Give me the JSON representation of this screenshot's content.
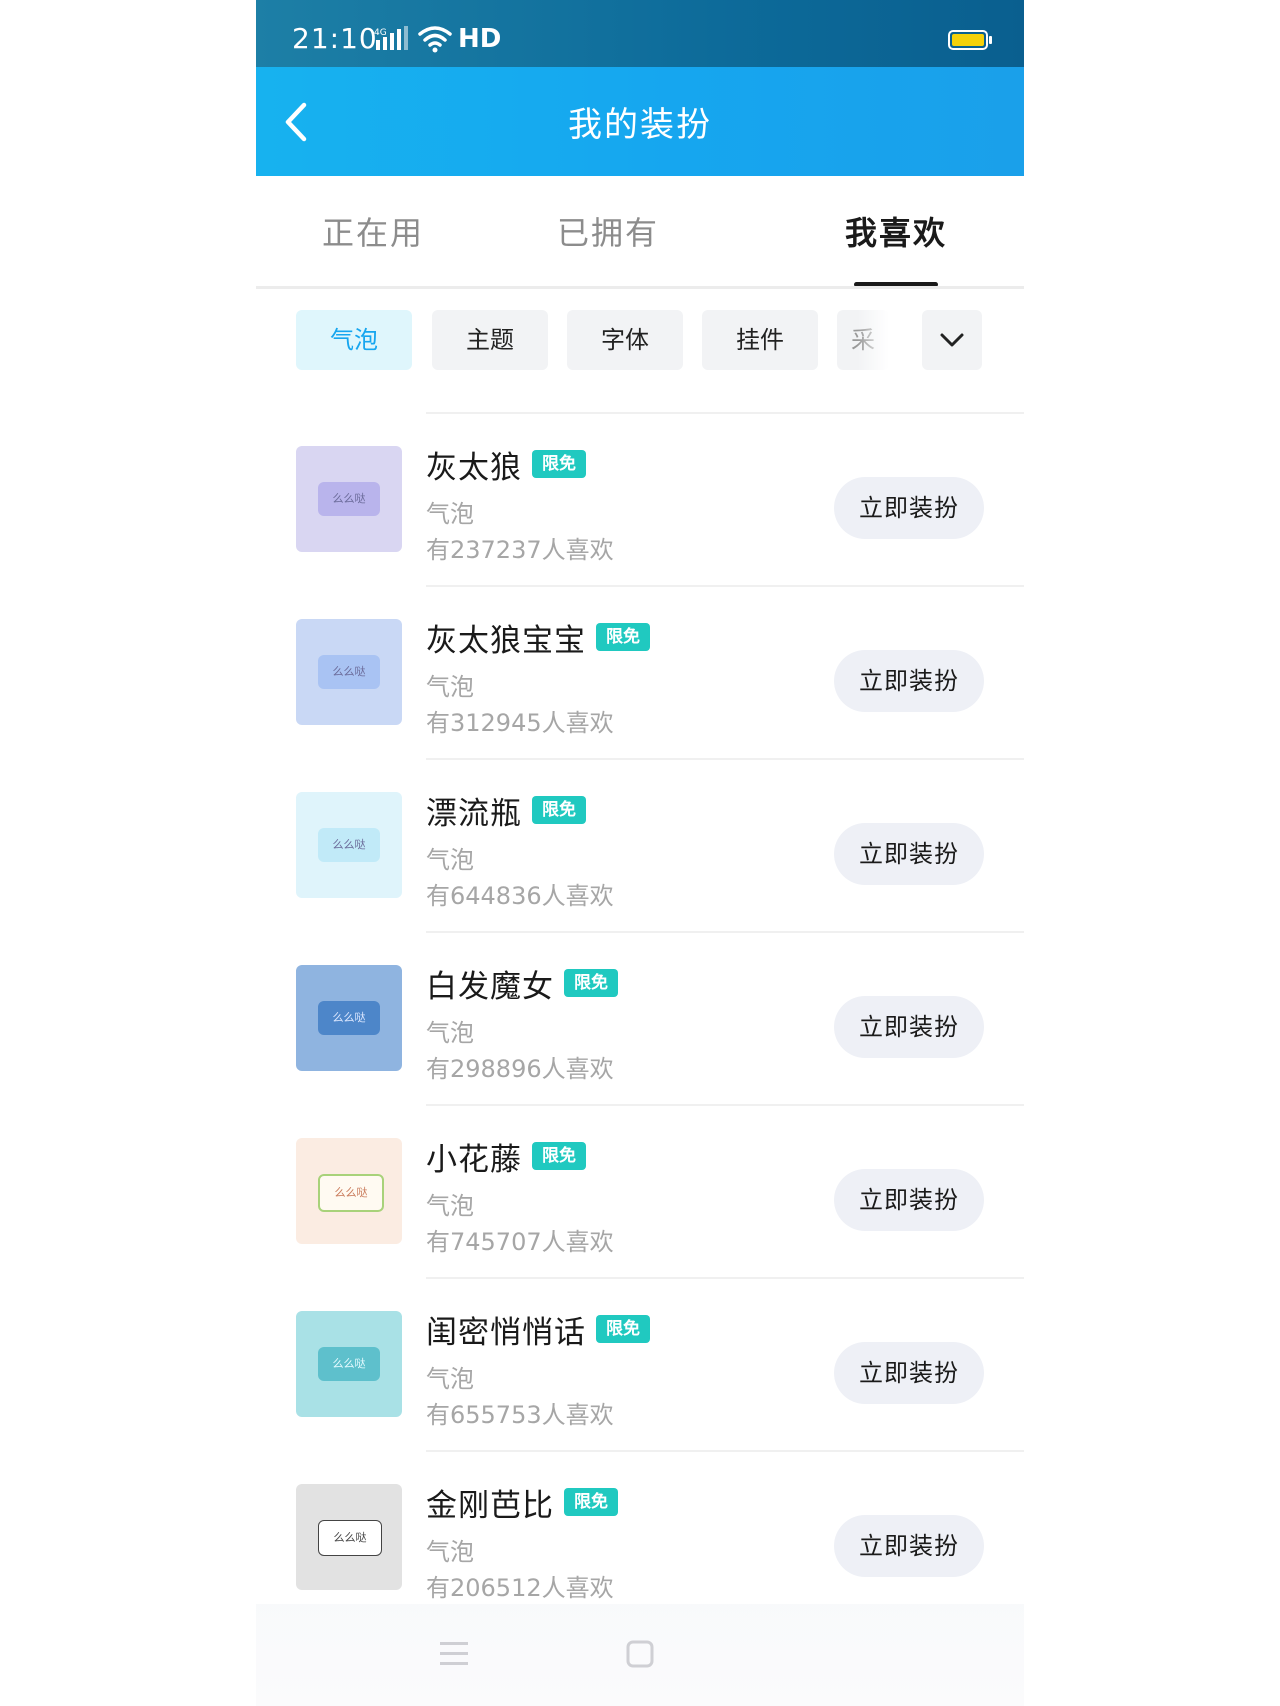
{
  "status_bar": {
    "time": "21:10",
    "network": "HD"
  },
  "header": {
    "title": "我的装扮",
    "back_icon": "chevron-left-icon"
  },
  "tabs": [
    {
      "label": "正在用",
      "active": false
    },
    {
      "label": "已拥有",
      "active": false
    },
    {
      "label": "我喜欢",
      "active": true
    }
  ],
  "categories": [
    {
      "label": "气泡",
      "active": true
    },
    {
      "label": "主题",
      "active": false
    },
    {
      "label": "字体",
      "active": false
    },
    {
      "label": "挂件",
      "active": false
    },
    {
      "label": "采",
      "active": false
    }
  ],
  "expand_icon": "chevron-down-icon",
  "items": [
    {
      "title": "灰太狼",
      "badge": "限免",
      "type": "气泡",
      "likes": "有237237人喜欢",
      "action": "立即装扮",
      "thumb_bg": "#d9d6f2",
      "bubble_bg": "#b9b4ec",
      "bubble_text": "么么哒"
    },
    {
      "title": "灰太狼宝宝",
      "badge": "限免",
      "type": "气泡",
      "likes": "有312945人喜欢",
      "action": "立即装扮",
      "thumb_bg": "#c9d8f5",
      "bubble_bg": "#a9c3f3",
      "bubble_text": "么么哒"
    },
    {
      "title": "漂流瓶",
      "badge": "限免",
      "type": "气泡",
      "likes": "有644836人喜欢",
      "action": "立即装扮",
      "thumb_bg": "#dff4fb",
      "bubble_bg": "#c1eaf8",
      "bubble_text": "么么哒"
    },
    {
      "title": "白发魔女",
      "badge": "限免",
      "type": "气泡",
      "likes": "有298896人喜欢",
      "action": "立即装扮",
      "thumb_bg": "#8fb4e0",
      "bubble_bg": "#4d86c9",
      "bubble_text": "么么哒"
    },
    {
      "title": "小花藤",
      "badge": "限免",
      "type": "气泡",
      "likes": "有745707人喜欢",
      "action": "立即装扮",
      "thumb_bg": "#fbece2",
      "bubble_bg": "#fffaf2",
      "bubble_text": "么么哒"
    },
    {
      "title": "闺密悄悄话",
      "badge": "限免",
      "type": "气泡",
      "likes": "有655753人喜欢",
      "action": "立即装扮",
      "thumb_bg": "#a9e1e6",
      "bubble_bg": "#5ec0cc",
      "bubble_text": "么么哒"
    },
    {
      "title": "金刚芭比",
      "badge": "限免",
      "type": "气泡",
      "likes": "有206512人喜欢",
      "action": "立即装扮",
      "thumb_bg": "#e2e2e2",
      "bubble_bg": "#ffffff",
      "bubble_text": "么么哒"
    }
  ],
  "nav": {
    "menu_icon": "menu-icon",
    "home_icon": "home-square-icon"
  }
}
